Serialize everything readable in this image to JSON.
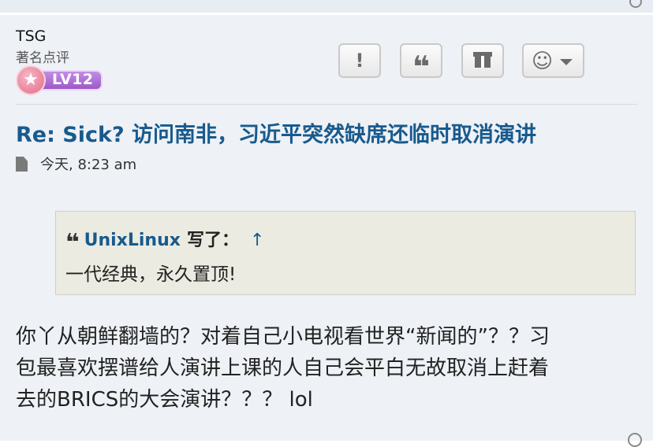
{
  "post": {
    "author": {
      "name": "TSG",
      "rank": "著名点评",
      "badge_level": "LV12",
      "badge_icon": "star-icon"
    },
    "actions": [
      {
        "name": "report",
        "label": "!"
      },
      {
        "name": "quote",
        "label": "❝"
      },
      {
        "name": "gift",
        "label": ""
      },
      {
        "name": "more",
        "label": "☺"
      }
    ],
    "title": "Re: Sick? 访问南非，习近平突然缺席还临时取消演讲",
    "timestamp": "今天, 8:23 am",
    "quote": {
      "author": "UnixLinux",
      "wrote_label": "写了：",
      "arrow": "↑",
      "text": "一代经典，永久置顶!"
    },
    "body_lines": [
      "你丫从朝鲜翻墙的？对着自己小电视看世界“新闻的”？？习",
      "包最喜欢摆谱给人演讲上课的人自己会平白无故取消上赶着",
      "去的BRICS的大会演讲？？？ lol"
    ]
  },
  "colors": {
    "title": "#185a8d",
    "post_bg": "#eef1f6",
    "quote_bg": "#ebebe1",
    "badge": "#a86fd4"
  }
}
